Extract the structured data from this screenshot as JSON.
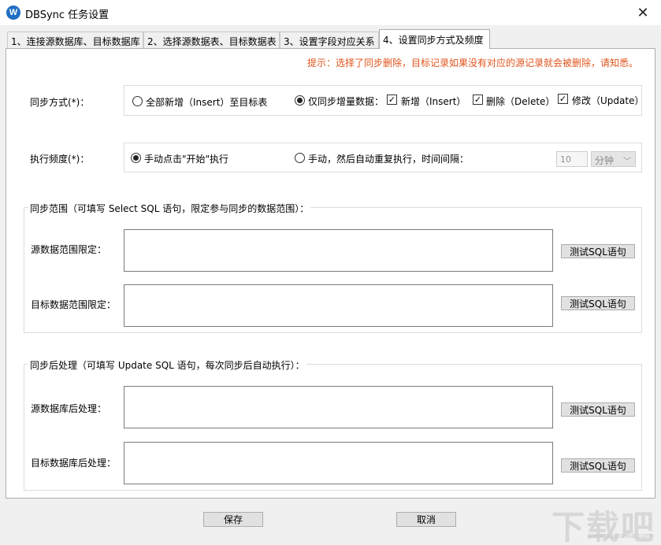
{
  "window": {
    "app_icon_text": "W",
    "title": "DBSync 任务设置",
    "close_glyph": "✕"
  },
  "tabs": [
    {
      "label": "1、连接源数据库、目标数据库"
    },
    {
      "label": "2、选择源数据表、目标数据表"
    },
    {
      "label": "3、设置字段对应关系"
    },
    {
      "label": "4、设置同步方式及频度"
    }
  ],
  "active_tab_index": 3,
  "hint": "提示：选择了同步删除，目标记录如果没有对应的源记录就会被删除，请知悉。",
  "sync_mode": {
    "label": "同步方式(*)：",
    "option_full": "全部新增（Insert）至目标表",
    "option_incremental": "仅同步增量数据：",
    "selected": "incremental",
    "check_insert": {
      "label": "新增（Insert）",
      "checked": true
    },
    "check_delete": {
      "label": "删除（Delete）",
      "checked": true
    },
    "check_update": {
      "label": "修改（Update）",
      "checked": true
    }
  },
  "frequency": {
    "label": "执行频度(*)：",
    "option_manual": "手动点击\"开始\"执行",
    "option_repeat": "手动，然后自动重复执行，时间间隔：",
    "selected": "manual",
    "interval_value": "10",
    "interval_unit": "分钟"
  },
  "scope": {
    "legend": "同步范围（可填写 Select SQL 语句，限定参与同步的数据范围）：",
    "source_label": "源数据范围限定：",
    "target_label": "目标数据范围限定：",
    "source_value": "",
    "target_value": "",
    "test_button": "测试SQL语句"
  },
  "post": {
    "legend": "同步后处理（可填写 Update SQL 语句，每次同步后自动执行）：",
    "source_label": "源数据库后处理：",
    "target_label": "目标数据库后处理：",
    "source_value": "",
    "target_value": "",
    "test_button": "测试SQL语句"
  },
  "footer": {
    "save": "保存",
    "cancel": "取消"
  },
  "watermark": {
    "text": "下载吧",
    "url": "www.xiazaiba.com"
  },
  "colors": {
    "hint": "#e0541c",
    "icon": "#1f6fc5"
  }
}
